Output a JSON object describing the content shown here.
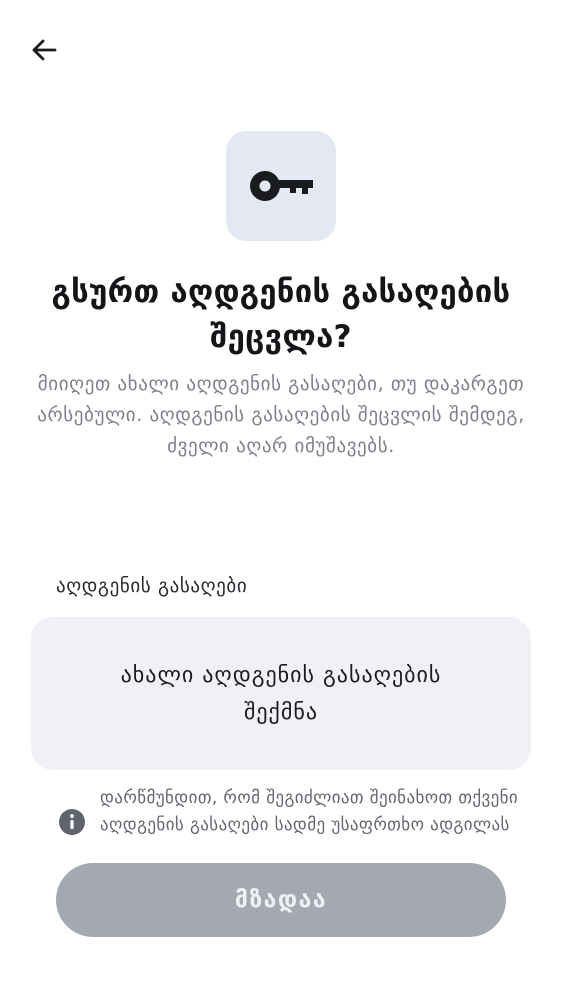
{
  "header": {
    "back_icon": "arrow-left-icon"
  },
  "hero": {
    "icon": "key-icon",
    "title": "გსურთ აღდგენის გასაღების შეცვლა?",
    "description": "მიიღეთ ახალი აღდგენის გასაღები, თუ დაკარგეთ არსებული. აღდგენის გასაღების შეცვლის შემდეგ, ძველი აღარ იმუშავებს."
  },
  "recovery_key": {
    "label": "აღდგენის გასაღები",
    "create_button_label": "ახალი აღდგენის გასაღების შექმნა"
  },
  "notice": {
    "icon": "info-icon",
    "text": "დარწმუნდით, რომ შეგიძლიათ შეინახოთ თქვენი აღდგენის გასაღები სადმე უსაფრთხო ადგილას"
  },
  "footer": {
    "ready_button_label": "მზადაა",
    "ready_enabled": false
  },
  "colors": {
    "key_tile_bg": "#e4e8f2",
    "create_button_bg": "#eff1f6",
    "ready_button_disabled_bg": "#a3a8b1",
    "title_text": "#141519",
    "secondary_text": "#7b7f88"
  }
}
